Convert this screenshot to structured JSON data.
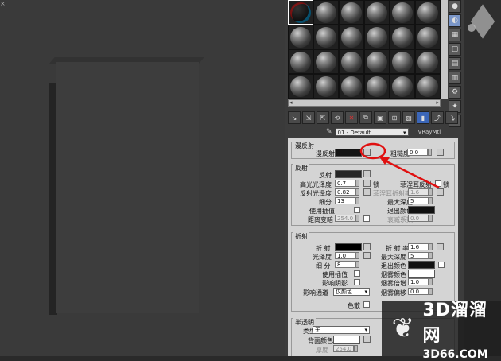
{
  "viewport": {
    "corner_label": "×"
  },
  "material_slots": {
    "rows": 4,
    "cols": 6,
    "active_index": 0
  },
  "toolbar": {
    "icons": [
      "get-material-icon",
      "put-to-scene-icon",
      "assign-icon",
      "reset-icon",
      "delete-icon",
      "make-unique-icon",
      "put-to-library-icon",
      "material-id-icon",
      "show-map-icon",
      "show-end-result-icon",
      "go-to-parent-icon",
      "go-forward-icon"
    ]
  },
  "material_name": "01 - Default",
  "material_type": "VRayMtl",
  "diffuse": {
    "title": "漫反射",
    "diffuse_label": "漫反射",
    "roughness_label": "粗糙度",
    "roughness_value": "0.0",
    "diffuse_color": "#141414"
  },
  "reflection": {
    "title": "反射",
    "reflect_label": "反射",
    "reflect_color": "#262626",
    "hilight_gloss_label": "高光光泽度",
    "hilight_gloss_value": "0.7",
    "lock_label": "锁",
    "fresnel_label": "菲涅耳反射",
    "refl_gloss_label": "反射光泽度",
    "refl_gloss_value": "0.82",
    "fresnel_ior_label": "菲涅耳折射率",
    "fresnel_ior_value": "1.6",
    "subdivs_label": "细分",
    "subdivs_value": "13",
    "max_depth_label": "最大深度",
    "max_depth_value": "5",
    "use_interp_label": "使用插值",
    "exit_color_label": "退出颜色",
    "exit_color": "#111111",
    "dim_distance_label": "距离变暗",
    "dim_distance_value": "254.0",
    "dim_falloff_label": "衰减系数",
    "dim_falloff_value": "0.0"
  },
  "refraction": {
    "title": "折射",
    "refract_label": "折 射",
    "refract_color": "#000000",
    "ior_label": "折 射 率",
    "ior_value": "1.6",
    "gloss_label": "光泽度",
    "gloss_value": "1.0",
    "max_depth_label": "最大深度",
    "max_depth_value": "5",
    "subdivs_label": "细 分",
    "subdivs_value": "8",
    "exit_color_label": "退出颜色",
    "use_interp_label": "使用插值",
    "fog_color_label": "烟雾颜色",
    "fog_color": "#ffffff",
    "affect_shadows_label": "影响阴影",
    "fog_mult_label": "烟雾倍增",
    "fog_mult_value": "1.0",
    "affect_channels_label": "影响通道",
    "affect_channels_value": "仅颜色",
    "fog_bias_label": "烟雾偏移",
    "fog_bias_value": "0.0",
    "dispersion_label": "色散"
  },
  "translucency": {
    "title": "半透明",
    "type_label": "类型",
    "type_value": "无",
    "back_color_label": "背面颜色",
    "back_color": "#ffffff",
    "thickness_label": "厚度",
    "thickness_value": "254.0"
  },
  "watermark": {
    "line1": "3D溜溜网",
    "line2": "3D66.COM"
  },
  "colors": {
    "annotation_red": "#e01010"
  }
}
